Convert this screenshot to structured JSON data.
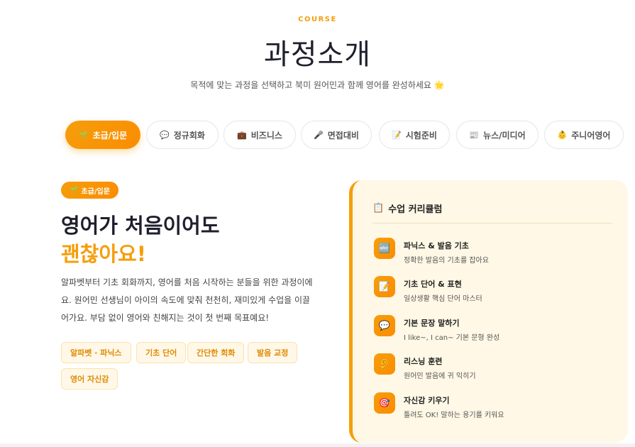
{
  "header": {
    "eyebrow": "COURSE",
    "title": "과정소개",
    "subtitle": "목적에 맞는 과정을 선택하고 북미 원어민과 함께 영어를 완성하세요 🌟"
  },
  "tabs": [
    {
      "icon": "🌱",
      "label": "초급/입문",
      "active": true
    },
    {
      "icon": "💬",
      "label": "정규회화",
      "active": false
    },
    {
      "icon": "💼",
      "label": "비즈니스",
      "active": false
    },
    {
      "icon": "🎤",
      "label": "면접대비",
      "active": false
    },
    {
      "icon": "📝",
      "label": "시험준비",
      "active": false
    },
    {
      "icon": "📰",
      "label": "뉴스/미디어",
      "active": false
    },
    {
      "icon": "👶",
      "label": "주니어영어",
      "active": false
    }
  ],
  "course": {
    "badge_icon": "🌱",
    "badge_label": "초급/입문",
    "headline_line1": "영어가 처음이어도",
    "headline_line2": "괜찮아요!",
    "description": "알파벳부터 기초 회화까지, 영어를 처음 시작하는 분들을 위한 과정이에요. 원어민 선생님이 아이의 속도에 맞춰 천천히, 재미있게 수업을 이끌어가요. 부담 없이 영어와 친해지는 것이 첫 번째 목표예요!",
    "chips": [
      "알파벳 · 파닉스",
      "기초 단어",
      "간단한 회화",
      "발음 교정",
      "영어 자신감"
    ]
  },
  "curriculum": {
    "title_icon": "📋",
    "title": "수업 커리큘럼",
    "items": [
      {
        "icon": "🔤",
        "name": "파닉스 & 발음 기초",
        "desc": "정확한 발음의 기초를 잡아요"
      },
      {
        "icon": "📝",
        "name": "기초 단어 & 표현",
        "desc": "일상생활 핵심 단어 마스터"
      },
      {
        "icon": "💬",
        "name": "기본 문장 말하기",
        "desc": "I like~, I can~ 기본 문형 완성"
      },
      {
        "icon": "👂",
        "name": "리스닝 훈련",
        "desc": "원어민 발음에 귀 익히기"
      },
      {
        "icon": "🎯",
        "name": "자신감 키우기",
        "desc": "틀려도 OK! 말하는 용기를 키워요"
      }
    ]
  },
  "colors": {
    "accent": "#f59e0b",
    "accent_dark": "#fb8c00",
    "panel_bg": "#fff8e6",
    "chip_bg": "#fff8e8"
  }
}
